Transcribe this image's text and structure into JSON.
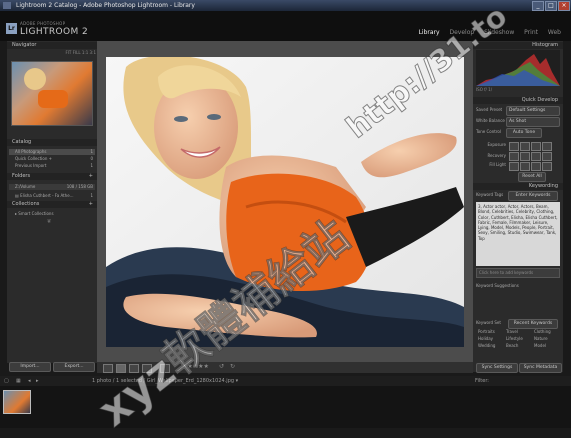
{
  "window": {
    "title": "Lightroom 2 Catalog - Adobe Photoshop Lightroom - Library",
    "controls": [
      "_",
      "□",
      "×"
    ]
  },
  "brand": {
    "logo": "Lr",
    "small": "ADOBE PHOTOSHOP",
    "big": "LIGHTROOM 2"
  },
  "modules": {
    "items": [
      "Library",
      "Develop",
      "Slideshow",
      "Print",
      "Web"
    ],
    "active": "Library"
  },
  "left_panel": {
    "navigator": {
      "title": "Navigator",
      "zoom": "FIT  FILL  1:1  3:1"
    },
    "catalog": {
      "title": "Catalog",
      "items": [
        {
          "label": "All Photographs",
          "count": "1"
        },
        {
          "label": "Quick Collection +",
          "count": "0"
        },
        {
          "label": "Previous Import",
          "count": "1"
        }
      ]
    },
    "folders": {
      "title": "Folders",
      "volume": "Z:/Volume",
      "volume_info": "108 / 158 GB",
      "folder": "Elisha Cuthbert - Fa Athe...",
      "folder_count": "1"
    },
    "collections": {
      "title": "Collections",
      "item": "Smart Collections"
    },
    "buttons": {
      "import": "Import...",
      "export": "Export..."
    }
  },
  "right_panel": {
    "histogram": {
      "title": "Histogram",
      "info": "ISO  f/  1/  "
    },
    "quick_develop": {
      "title": "Quick Develop",
      "saved_preset_label": "Saved Preset",
      "saved_preset": "Default Settings",
      "white_balance_label": "White Balance",
      "white_balance": "As Shot",
      "tone_control_label": "Tone Control",
      "tone_control": "Auto Tone",
      "exposure_label": "Exposure",
      "recovery_label": "Recovery",
      "fill_light_label": "Fill Light",
      "reset": "Reset All"
    },
    "keywording": {
      "title": "Keywording",
      "tags_label": "Keyword Tags",
      "tags_mode": "Enter Keywords",
      "keywords_text": "3, Actor actor, Actor, Actors, Beam, Blond, Celebrities, Celebrity, Clothing, Color, Cuthbert, Elisha, Elisha Cuthbert, Fabric, Female, Filmmaker, Leisure, Lying, Model, Models, People, Portrait, Sexy, Smiling, Studio, Swimwear, Tank, Top",
      "add_label": "Click here to add keywords",
      "suggestions_label": "Keyword Suggestions",
      "keyword_set_label": "Keyword Set",
      "keyword_set": "Recent Keywords",
      "set_keywords": [
        "Portraits",
        "Travel",
        "Clothing",
        "Holiday",
        "Lifestyle",
        "Nature",
        "Wedding",
        "Beach",
        "Model"
      ]
    },
    "buttons": {
      "sync": "Sync Settings",
      "sync_meta": "Sync Metadata"
    }
  },
  "toolbar": {
    "stars": "★★★★★"
  },
  "filmstrip": {
    "info": "1 photo / 1 selected / Girl_Wallpaper_Erd_1280x1024.jpg ▾",
    "filter_label": "Filter:"
  },
  "watermark": {
    "url": "http://31.to",
    "chars": "xyz軟體補給站"
  }
}
